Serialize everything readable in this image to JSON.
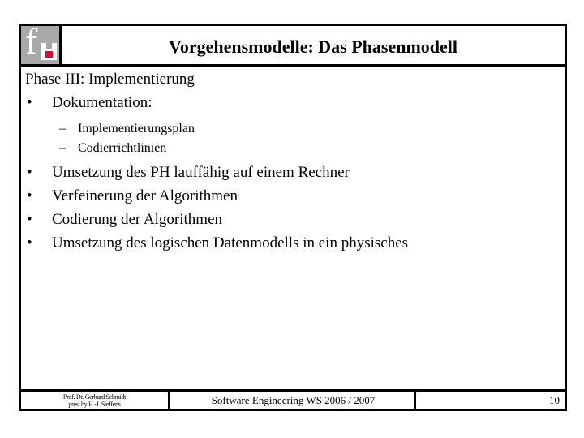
{
  "header": {
    "logo": {
      "icon": "fh-logo-icon",
      "letter": "f",
      "background_color": "#a8a8a8",
      "accent_color": "#d0102c"
    },
    "title": "Vorgehensmodelle: Das Phasenmodell"
  },
  "content": {
    "heading": "Phase III: Implementierung",
    "bullet_marker": "•",
    "sub_marker": "–",
    "items": [
      {
        "label": "Dokumentation:",
        "subitems": [
          "Implementierungsplan",
          "Codierrichtlinien"
        ]
      },
      {
        "label": "Umsetzung des PH lauffähig auf einem Rechner"
      },
      {
        "label": "Verfeinerung der Algorithmen"
      },
      {
        "label": "Codierung der Algorithmen"
      },
      {
        "label": "Umsetzung des logischen Datenmodells in ein physisches"
      }
    ]
  },
  "footer": {
    "author_line1": "Prof. Dr. Gerhard Schmidt",
    "author_line2": "pres. by H.-J. Steffens",
    "course": "Software Engineering WS 2006 / 2007",
    "page_number": "10"
  }
}
